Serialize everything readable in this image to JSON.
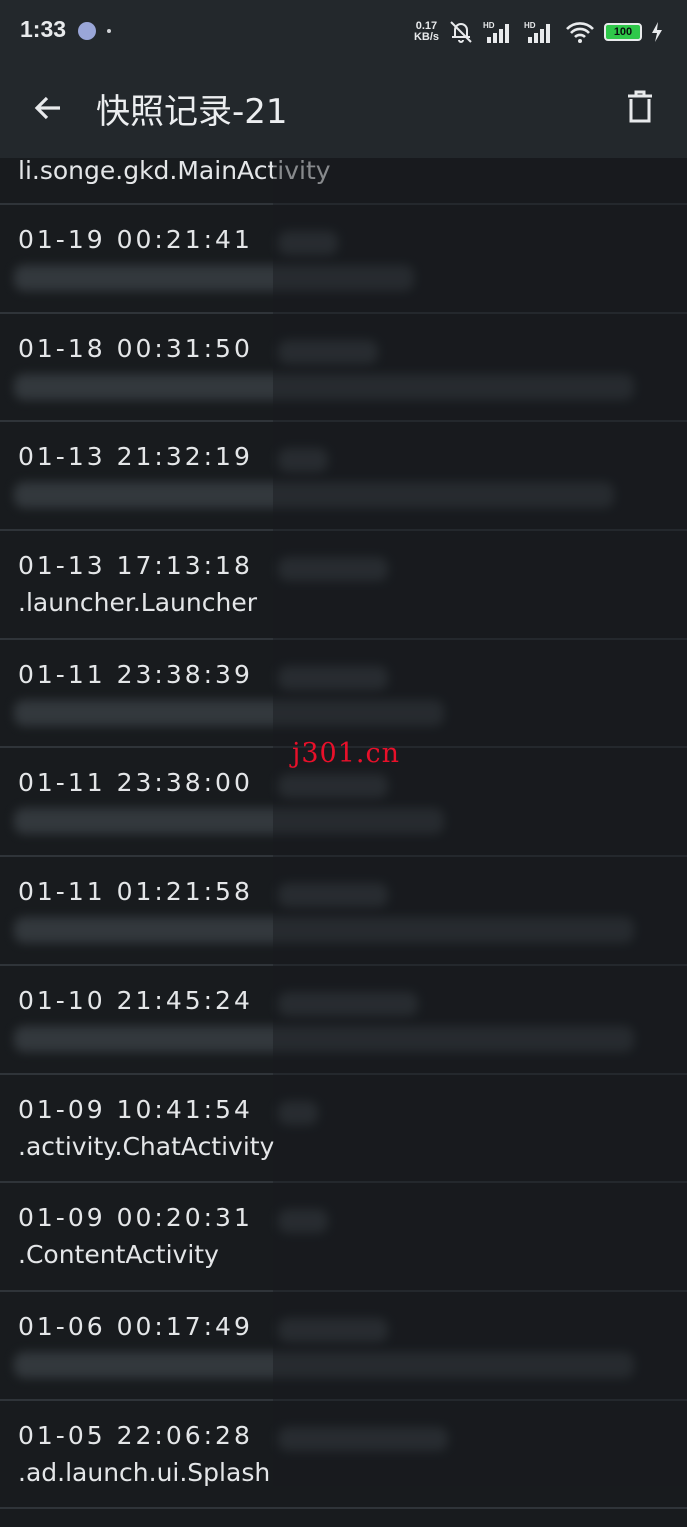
{
  "status_bar": {
    "time": "1:33",
    "net_speed_value": "0.17",
    "net_speed_unit": "KB/s",
    "battery": "100"
  },
  "app_bar": {
    "title": "快照记录-21",
    "back_icon": "arrow-left-icon",
    "delete_icon": "trash-icon"
  },
  "snapshots": {
    "first_partial_activity": "li.songe.gkd.MainActivity",
    "items": [
      {
        "time": "01-19  00:21:41",
        "activity": ""
      },
      {
        "time": "01-18  00:31:50",
        "activity": ""
      },
      {
        "time": "01-13  21:32:19",
        "activity": ""
      },
      {
        "time": "01-13  17:13:18",
        "activity": ".launcher.Launcher"
      },
      {
        "time": "01-11  23:38:39",
        "activity": ""
      },
      {
        "time": "01-11  23:38:00",
        "activity": ""
      },
      {
        "time": "01-11  01:21:58",
        "activity": ""
      },
      {
        "time": "01-10  21:45:24",
        "activity": ""
      },
      {
        "time": "01-09  10:41:54",
        "activity": ".activity.ChatActivity"
      },
      {
        "time": "01-09  00:20:31",
        "activity": ".ContentActivity"
      },
      {
        "time": "01-06  00:17:49",
        "activity": ""
      },
      {
        "time": "01-05  22:06:28",
        "activity": ".ad.launch.ui.Splash"
      }
    ]
  },
  "watermark": "j301.cn"
}
